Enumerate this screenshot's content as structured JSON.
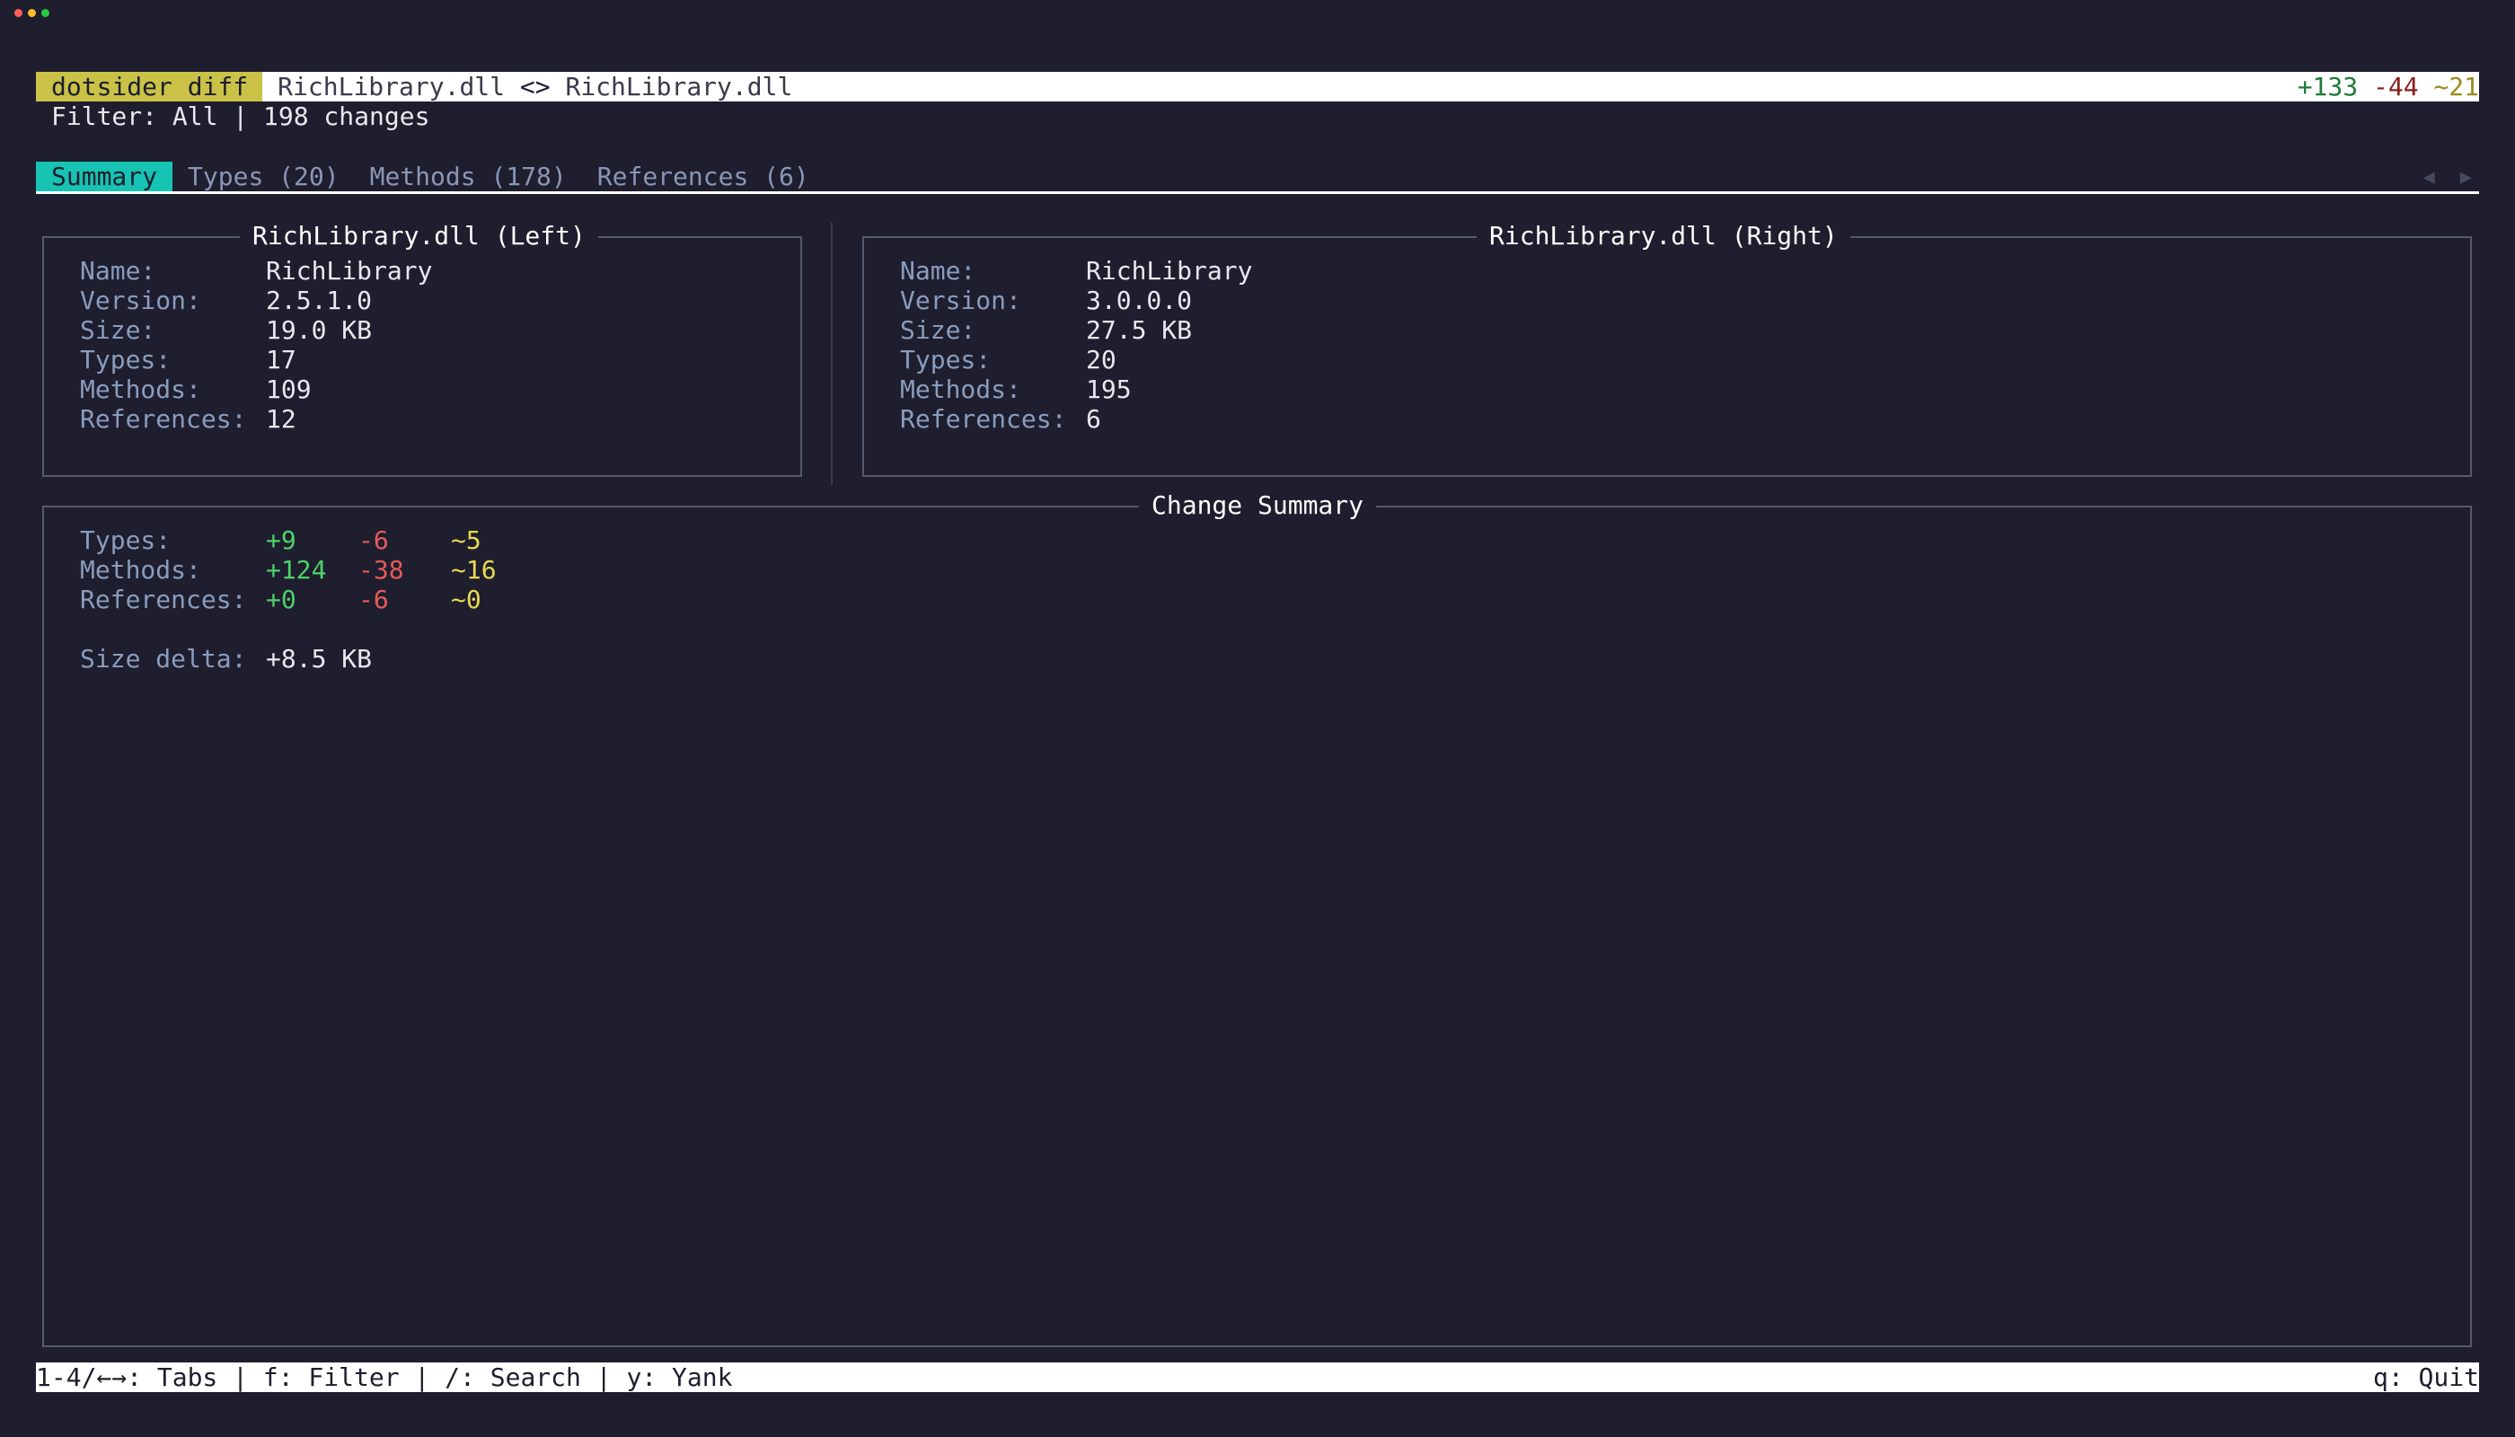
{
  "titlebar": {
    "app": "dotsider diff",
    "left_file": "RichLibrary.dll",
    "separator": "<>",
    "right_file": "RichLibrary.dll",
    "added": "+133",
    "removed": "-44",
    "modified": "~21"
  },
  "filter": {
    "text": "Filter: All | 198 changes"
  },
  "tabs": [
    {
      "label": "Summary"
    },
    {
      "label": "Types (20)"
    },
    {
      "label": "Methods (178)"
    },
    {
      "label": "References (6)"
    }
  ],
  "tab_nav": {
    "prev": "◀",
    "next": "▶"
  },
  "left_panel": {
    "title": "RichLibrary.dll (Left)",
    "rows": [
      {
        "label": "Name:",
        "value": "RichLibrary"
      },
      {
        "label": "Version:",
        "value": "2.5.1.0"
      },
      {
        "label": "Size:",
        "value": "19.0 KB"
      },
      {
        "label": "Types:",
        "value": "17"
      },
      {
        "label": "Methods:",
        "value": "109"
      },
      {
        "label": "References:",
        "value": "12"
      }
    ]
  },
  "right_panel": {
    "title": "RichLibrary.dll (Right)",
    "rows": [
      {
        "label": "Name:",
        "value": "RichLibrary"
      },
      {
        "label": "Version:",
        "value": "3.0.0.0"
      },
      {
        "label": "Size:",
        "value": "27.5 KB"
      },
      {
        "label": "Types:",
        "value": "20"
      },
      {
        "label": "Methods:",
        "value": "195"
      },
      {
        "label": "References:",
        "value": "6"
      }
    ]
  },
  "change_summary": {
    "title": "Change Summary",
    "rows": [
      {
        "label": "Types:",
        "added": "+9",
        "removed": "-6",
        "modified": "~5"
      },
      {
        "label": "Methods:",
        "added": "+124",
        "removed": "-38",
        "modified": "~16"
      },
      {
        "label": "References:",
        "added": "+0",
        "removed": "-6",
        "modified": "~0"
      }
    ],
    "size_delta_label": "Size delta:",
    "size_delta_value": "+8.5 KB"
  },
  "statusbar": {
    "left": "1-4/←→: Tabs | f: Filter | /: Search | y: Yank",
    "right": "q: Quit"
  },
  "colors": {
    "background": "#1e1e2e",
    "accent_tab": "#17c3b2",
    "badge": "#c9c247",
    "added": "#4fd16a",
    "removed": "#e65a5a",
    "modified": "#e8d850"
  }
}
